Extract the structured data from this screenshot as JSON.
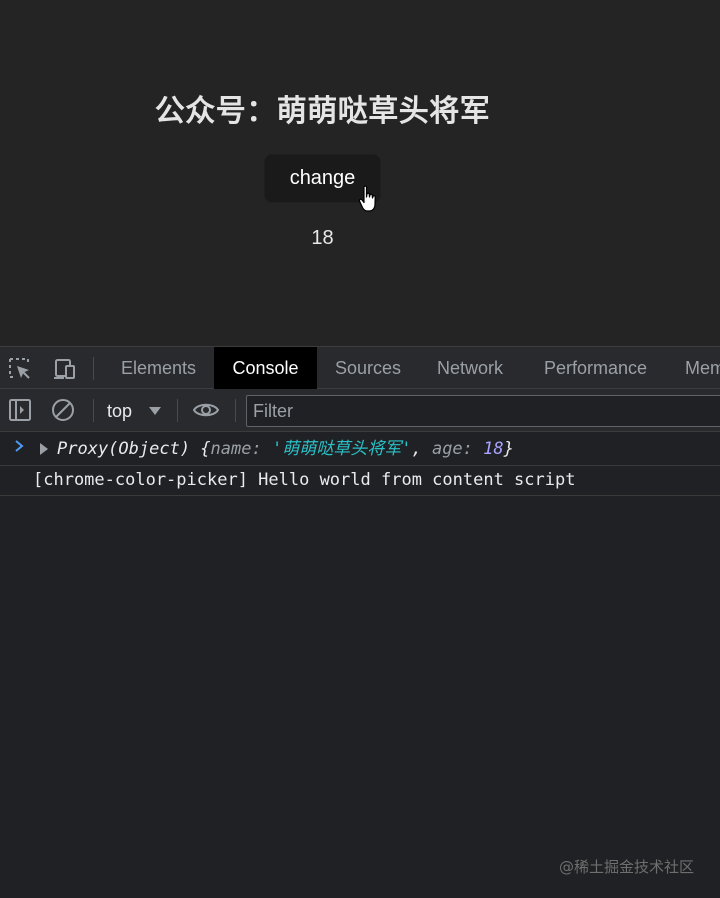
{
  "page": {
    "title": "公众号：萌萌哒草头将军",
    "button_label": "change",
    "count": "18"
  },
  "devtools": {
    "tabs": [
      "Elements",
      "Console",
      "Sources",
      "Network",
      "Performance",
      "Mem"
    ],
    "active_tab": "Console",
    "context": "top",
    "filter_placeholder": "Filter",
    "console": {
      "proxy": {
        "label": "Proxy(Object)",
        "open_brace": " {",
        "name_key": "name",
        "colon1": ": ",
        "name_value": "'萌萌哒草头将军'",
        "sep": ", ",
        "age_key": "age",
        "colon2": ": ",
        "age_value": "18",
        "close_brace": "}"
      },
      "log_message": "[chrome-color-picker] Hello world from content script"
    }
  },
  "watermark": "@稀土掘金技术社区",
  "colors": {
    "page_bg": "#242424",
    "devtools_bg": "#202124",
    "active_tab_bg": "#000000",
    "string_color": "#29c1c8",
    "number_color": "#a9a4ff"
  }
}
